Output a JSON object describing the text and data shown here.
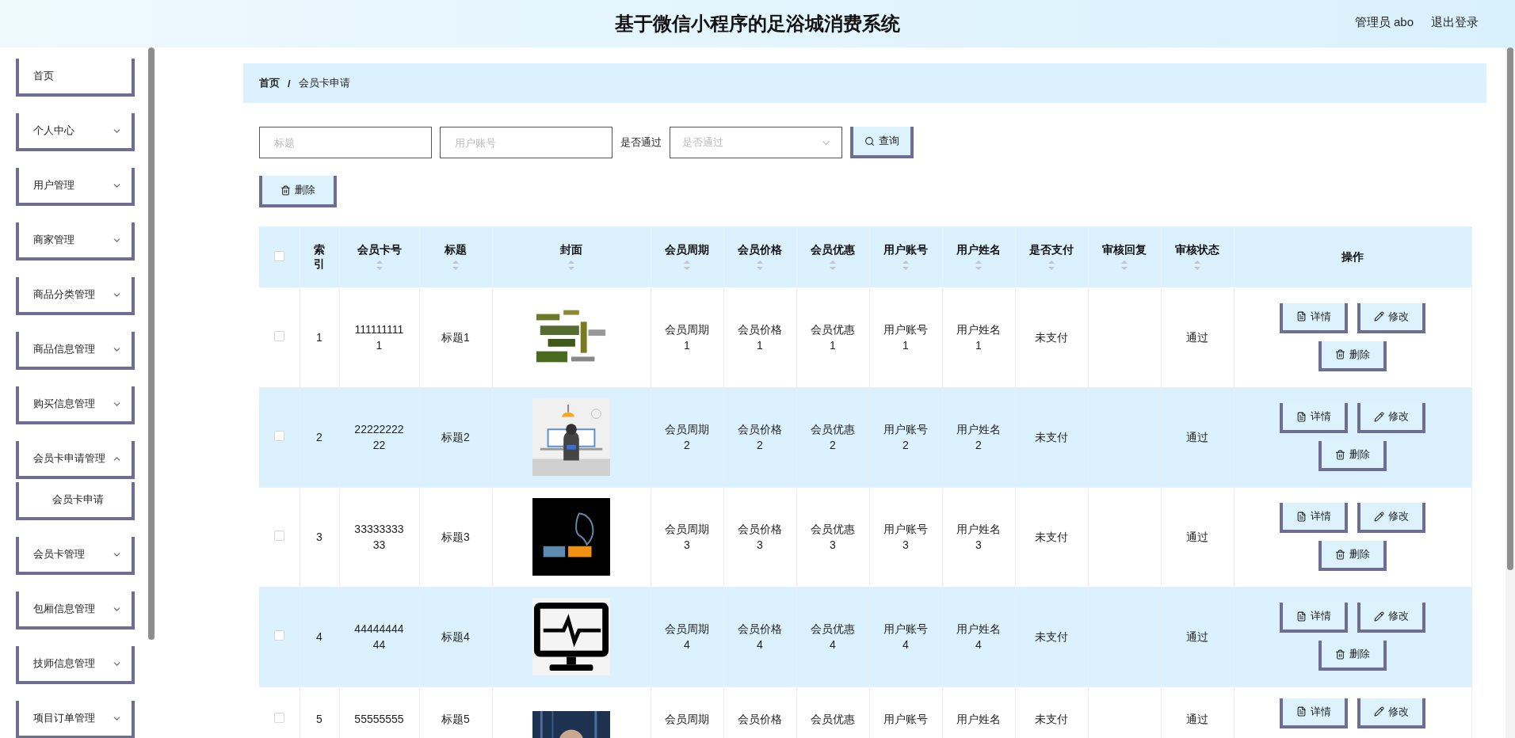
{
  "header": {
    "title": "基于微信小程序的足浴城消费系统",
    "user": "管理员 abo",
    "logout": "退出登录"
  },
  "sidebar": {
    "items": [
      {
        "label": "首页",
        "kind": "link"
      },
      {
        "label": "个人中心",
        "kind": "submenu",
        "expanded": false
      },
      {
        "label": "用户管理",
        "kind": "submenu",
        "expanded": false
      },
      {
        "label": "商家管理",
        "kind": "submenu",
        "expanded": false
      },
      {
        "label": "商品分类管理",
        "kind": "submenu",
        "expanded": false
      },
      {
        "label": "商品信息管理",
        "kind": "submenu",
        "expanded": false
      },
      {
        "label": "购买信息管理",
        "kind": "submenu",
        "expanded": false
      },
      {
        "label": "会员卡申请管理",
        "kind": "submenu",
        "expanded": true,
        "children": [
          {
            "label": "会员卡申请"
          }
        ]
      },
      {
        "label": "会员卡管理",
        "kind": "submenu",
        "expanded": false
      },
      {
        "label": "包厢信息管理",
        "kind": "submenu",
        "expanded": false
      },
      {
        "label": "技师信息管理",
        "kind": "submenu",
        "expanded": false
      },
      {
        "label": "项目订单管理",
        "kind": "submenu",
        "expanded": false
      }
    ]
  },
  "breadcrumb": {
    "items": [
      "首页",
      "会员卡申请"
    ],
    "separator": "/"
  },
  "search": {
    "fields": [
      {
        "kind": "input",
        "placeholder": "标题"
      },
      {
        "kind": "input",
        "placeholder": "用户账号"
      },
      {
        "kind": "label",
        "text": "是否通过"
      },
      {
        "kind": "select",
        "placeholder": "是否通过"
      }
    ],
    "button": "查询"
  },
  "delete_button": "删除",
  "table": {
    "select_all_checked": false,
    "columns": [
      {
        "label": "索引",
        "sortable": false
      },
      {
        "label": "会员卡号",
        "sortable": true
      },
      {
        "label": "标题",
        "sortable": true
      },
      {
        "label": "封面",
        "sortable": true
      },
      {
        "label": "会员周期",
        "sortable": true
      },
      {
        "label": "会员价格",
        "sortable": true
      },
      {
        "label": "会员优惠",
        "sortable": true
      },
      {
        "label": "用户账号",
        "sortable": true
      },
      {
        "label": "用户姓名",
        "sortable": true
      },
      {
        "label": "是否支付",
        "sortable": true
      },
      {
        "label": "审核回复",
        "sortable": true
      },
      {
        "label": "审核状态",
        "sortable": true
      },
      {
        "label": "操作",
        "sortable": false
      }
    ],
    "rows": [
      {
        "checked": false,
        "cells": [
          "1",
          "1111111111",
          "标题1",
          {
            "kind": "picture"
          },
          "会员周期1",
          "会员价格1",
          "会员优惠1",
          "用户账号1",
          "用户姓名1",
          "未支付",
          "",
          "通过"
        ],
        "actions": [
          "详情",
          "修改",
          "删除"
        ]
      },
      {
        "checked": false,
        "cells": [
          "2",
          "2222222222",
          "标题2",
          {
            "kind": "picture"
          },
          "会员周期2",
          "会员价格2",
          "会员优惠2",
          "用户账号2",
          "用户姓名2",
          "未支付",
          "",
          "通过"
        ],
        "actions": [
          "详情",
          "修改",
          "删除"
        ]
      },
      {
        "checked": false,
        "cells": [
          "3",
          "3333333333",
          "标题3",
          {
            "kind": "picture"
          },
          "会员周期3",
          "会员价格3",
          "会员优惠3",
          "用户账号3",
          "用户姓名3",
          "未支付",
          "",
          "通过"
        ],
        "actions": [
          "详情",
          "修改",
          "删除"
        ]
      },
      {
        "checked": false,
        "cells": [
          "4",
          "4444444444",
          "标题4",
          {
            "kind": "picture"
          },
          "会员周期4",
          "会员价格4",
          "会员优惠4",
          "用户账号4",
          "用户姓名4",
          "未支付",
          "",
          "通过"
        ],
        "actions": [
          "详情",
          "修改",
          "删除"
        ]
      },
      {
        "checked": false,
        "cells": [
          "5",
          "55555555",
          "标题5",
          {
            "kind": "picture"
          },
          "会员周期",
          "会员价格",
          "会员优惠",
          "用户账号",
          "用户姓名",
          "未支付",
          "",
          "通过"
        ],
        "actions": [
          "详情",
          "修改"
        ]
      }
    ]
  }
}
